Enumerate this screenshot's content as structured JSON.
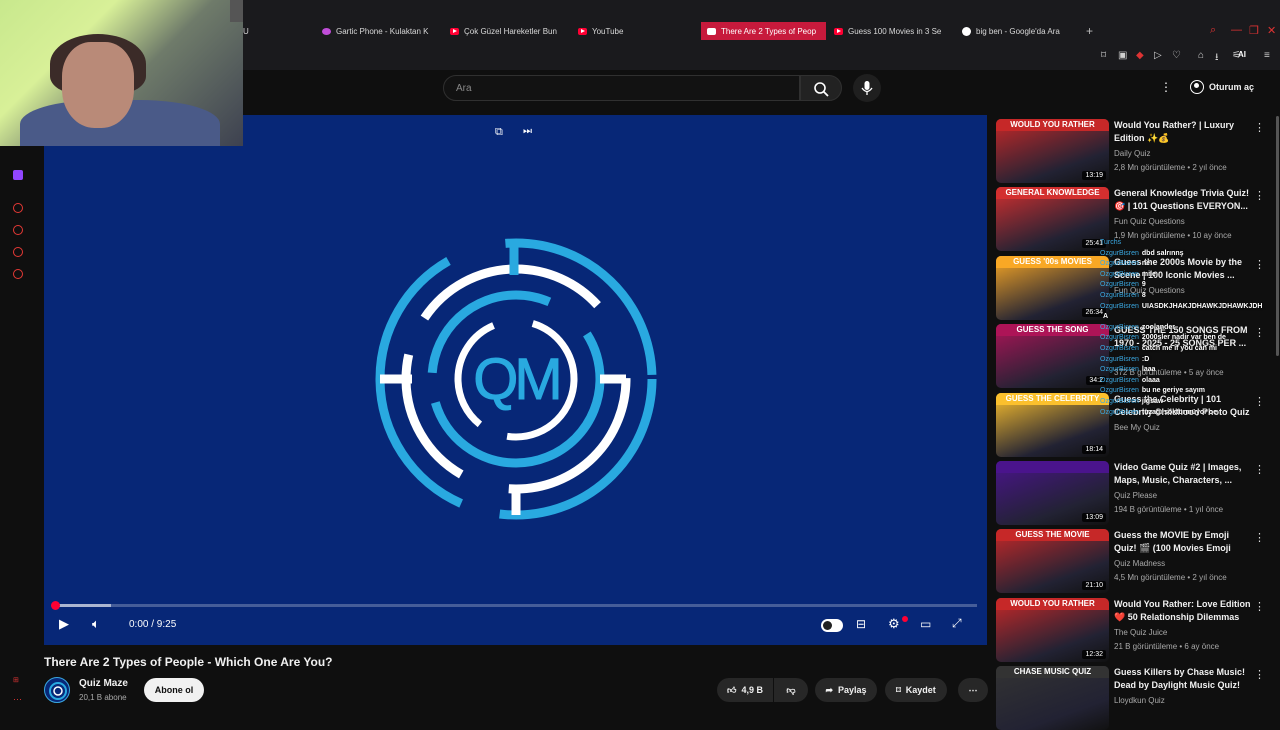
{
  "browser": {
    "tabs": [
      {
        "label": "U",
        "icon": "partial-tab"
      },
      {
        "label": "Gartic Phone - Kulaktan K",
        "icon": "gartic-phone-favicon"
      },
      {
        "label": "Çok Güzel Hareketler Bun",
        "icon": "youtube-favicon"
      },
      {
        "label": "YouTube",
        "icon": "youtube-favicon"
      },
      {
        "label": "There Are 2 Types of Peop",
        "icon": "youtube-favicon",
        "active": true
      },
      {
        "label": "Guess 100 Movies in 3 Se",
        "icon": "youtube-favicon"
      },
      {
        "label": "big ben - Google'da Ara",
        "icon": "google-favicon"
      }
    ],
    "ai_label": "AI",
    "accent": "#c71a3c"
  },
  "header": {
    "search_placeholder": "Ara",
    "signin_label": "Oturum aç"
  },
  "player": {
    "time": "0:00 / 9:25",
    "background": "#072777",
    "logo_text": "QM",
    "progress_fraction": 0.0
  },
  "video": {
    "title": "There Are 2 Types of People - Which One Are You?",
    "channel": "Quiz Maze",
    "subscribers": "20,1 B abone",
    "subscribe_label": "Abone ol",
    "likes": "4,9 B",
    "share_label": "Paylaş",
    "save_label": "Kaydet"
  },
  "recommendations": [
    {
      "title": "Would You Rather? | Luxury Edition ✨💰",
      "channel": "Daily Quiz",
      "meta": "2,8 Mn görüntüleme • 2 yıl önce",
      "duration": "13:19",
      "banner": "WOULD YOU RATHER",
      "color": "#c62828"
    },
    {
      "title": "General Knowledge Trivia Quiz! 🎯 | 101 Questions EVERYON...",
      "channel": "Fun Quiz Questions",
      "meta": "1,9 Mn görüntüleme • 10 ay önce",
      "duration": "25:41",
      "banner": "GENERAL KNOWLEDGE",
      "color": "#d32f2f"
    },
    {
      "title": "Guess the 2000s Movie by the Scene | 100 Iconic Movies ...",
      "channel": "Fun Quiz Questions",
      "meta": "",
      "duration": "26:34",
      "banner": "GUESS '00s MOVIES",
      "color": "#f9a825"
    },
    {
      "title": "GUESS THE 150 SONGS FROM 1970 - 2025 - 25 SONGS PER ...",
      "channel": "",
      "meta": "372 B görüntüleme • 5 ay önce",
      "duration": "34:2",
      "banner": "GUESS THE SONG",
      "color": "#ad1457"
    },
    {
      "title": "Guess the Celebrity | 101 Celebrity Childhood Photo Quiz",
      "channel": "Bee My Quiz",
      "meta": "",
      "duration": "18:14",
      "banner": "GUESS THE CELEBRITY",
      "color": "#fbc02d"
    },
    {
      "title": "Video Game Quiz #2 | Images, Maps, Music, Characters, ...",
      "channel": "Quiz Please",
      "meta": "194 B görüntüleme • 1 yıl önce",
      "duration": "13:09",
      "banner": "",
      "color": "#4a148c"
    },
    {
      "title": "Guess the MOVIE by Emoji Quiz! 🎬 (100 Movies Emoji Puzzles...",
      "channel": "Quiz Madness",
      "meta": "4,5 Mn görüntüleme • 2 yıl önce",
      "duration": "21:10",
      "banner": "GUESS THE MOVIE",
      "color": "#c62828"
    },
    {
      "title": "Would You Rather: Love Edition ❤️ 50 Relationship Dilemmas",
      "channel": "The Quiz Juice",
      "meta": "21 B görüntüleme • 6 ay önce",
      "duration": "12:32",
      "banner": "WOULD YOU RATHER",
      "color": "#c62828"
    },
    {
      "title": "Guess Killers by Chase Music! Dead by Daylight Music Quiz!",
      "channel": "Lloydkun Quiz",
      "meta": "",
      "duration": "",
      "banner": "CHASE MUSIC QUIZ",
      "color": "#333333"
    }
  ],
  "chat": [
    {
      "user": "Turchs",
      "msg": ""
    },
    {
      "user": "OzgurBisren",
      "msg": "dbd salrınnş"
    },
    {
      "user": "OzgurBisren",
      "msg": "ne"
    },
    {
      "user": "OzgurBisren",
      "msg": "mile"
    },
    {
      "user": "OzgurBisren",
      "msg": "9"
    },
    {
      "user": "OzgurBisren",
      "msg": "8"
    },
    {
      "user": "OzgurBisren",
      "msg": "UIASDKJHAKJDHAWKJDHAWKJDH"
    },
    {
      "user": "",
      "msg": "A"
    },
    {
      "user": "OzgurBisren",
      "msg": "zoolander"
    },
    {
      "user": "OzgurBisren",
      "msg": "2000sler nadir var ben de"
    },
    {
      "user": "OzgurBisren",
      "msg": "catch me if you can mi"
    },
    {
      "user": "OzgurBisren",
      "msg": ":D"
    },
    {
      "user": "OzgurBisren",
      "msg": "laaa"
    },
    {
      "user": "OzgurBisren",
      "msg": "olaaa"
    },
    {
      "user": "OzgurBisren",
      "msg": "bu ne geriye sayım"
    },
    {
      "user": "OzgurBisren",
      "msg": "jigsaw"
    },
    {
      "user": "OzgurBisren",
      "msg": "tuzağı söktürmüyor oe"
    }
  ]
}
